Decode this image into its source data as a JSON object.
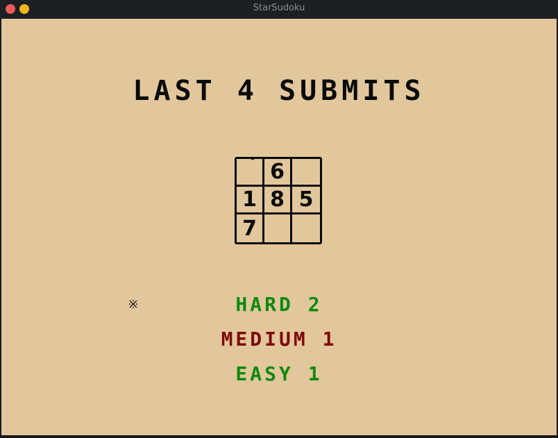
{
  "window": {
    "title": "StarSudoku"
  },
  "screen": {
    "heading": "LAST 4 SUBMITS",
    "grid": {
      "rows": [
        [
          "",
          "6",
          ""
        ],
        [
          "1",
          "8",
          "5"
        ],
        [
          "7",
          "",
          ""
        ]
      ]
    },
    "cursor_glyph": "⌘",
    "results": [
      {
        "label": "HARD 2",
        "color": "#0e8a0e"
      },
      {
        "label": "MEDIUM 1",
        "color": "#7d0a0a"
      },
      {
        "label": "EASY 1",
        "color": "#0e8a0e"
      }
    ]
  },
  "colors": {
    "background": "#e2c79c",
    "text": "#0a0a0a",
    "success": "#0e8a0e",
    "failure": "#7d0a0a"
  }
}
